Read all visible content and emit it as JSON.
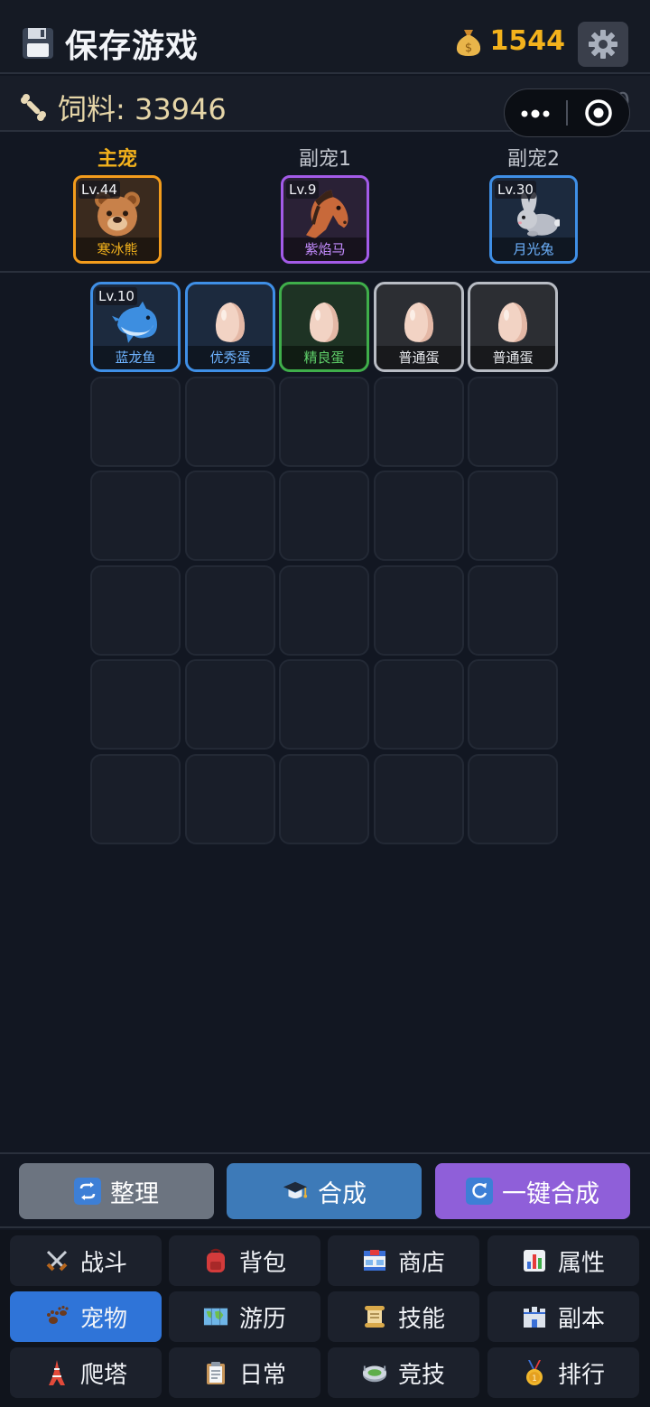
{
  "header": {
    "save_label": "保存游戏",
    "coins": "1544",
    "icons": {
      "save": "floppy-disk-icon",
      "coin": "money-bag-icon",
      "settings": "gear-icon"
    }
  },
  "feed": {
    "label": "饲料: 33946",
    "capacity": "5/30",
    "icon": "bone-icon"
  },
  "capsule": {
    "more_icon": "more-dots-icon",
    "close_icon": "target-circle-icon"
  },
  "equipped": {
    "main": {
      "label": "主宠",
      "level": "Lv.44",
      "name": "寒冰熊",
      "art": "bear",
      "border": "#f39c1c",
      "name_color": "#f3b21c",
      "bg": "#3a2a1e"
    },
    "sub1": {
      "label": "副宠1",
      "level": "Lv.9",
      "name": "紫焰马",
      "art": "horse",
      "border": "#a35be8",
      "name_color": "#c58cff",
      "bg": "#2a2136"
    },
    "sub2": {
      "label": "副宠2",
      "level": "Lv.30",
      "name": "月光兔",
      "art": "rabbit",
      "border": "#3f8fe6",
      "name_color": "#6eb3ff",
      "bg": "#1c2a3e"
    }
  },
  "bag": {
    "items": [
      {
        "level": "Lv.10",
        "name": "蓝龙鱼",
        "art": "dolphin",
        "border": "#3f8fe6",
        "name_color": "#6eb3ff",
        "bg": "#1c2a3e"
      },
      {
        "level": "",
        "name": "优秀蛋",
        "art": "egg",
        "border": "#3f8fe6",
        "name_color": "#6eb3ff",
        "bg": "#1c2a3e"
      },
      {
        "level": "",
        "name": "精良蛋",
        "art": "egg",
        "border": "#3fae4a",
        "name_color": "#5fd06a",
        "bg": "#1e3324"
      },
      {
        "level": "",
        "name": "普通蛋",
        "art": "egg",
        "border": "#b8bcc4",
        "name_color": "#e6e8ec",
        "bg": "#2c2e33"
      },
      {
        "level": "",
        "name": "普通蛋",
        "art": "egg",
        "border": "#b8bcc4",
        "name_color": "#e6e8ec",
        "bg": "#2c2e33"
      }
    ],
    "total_slots": 30
  },
  "actions": [
    {
      "label": "整理",
      "icon": "repeat-arrows-icon",
      "bg": "#6c7480",
      "icon_bg": "#3d7fd6"
    },
    {
      "label": "合成",
      "icon": "mortarboard-icon",
      "bg": "#3d7ab8",
      "icon_bg": "transparent"
    },
    {
      "label": "一键合成",
      "icon": "refresh-icon",
      "bg": "#8f5fd9",
      "icon_bg": "#3d7fd6"
    }
  ],
  "nav": [
    {
      "label": "战斗",
      "icon": "crossed-swords-icon",
      "active": false
    },
    {
      "label": "背包",
      "icon": "backpack-icon",
      "active": false
    },
    {
      "label": "商店",
      "icon": "convenience-store-icon",
      "active": false
    },
    {
      "label": "属性",
      "icon": "bar-chart-icon",
      "active": false
    },
    {
      "label": "宠物",
      "icon": "paw-prints-icon",
      "active": true
    },
    {
      "label": "游历",
      "icon": "world-map-icon",
      "active": false
    },
    {
      "label": "技能",
      "icon": "scroll-icon",
      "active": false
    },
    {
      "label": "副本",
      "icon": "castle-icon",
      "active": false
    },
    {
      "label": "爬塔",
      "icon": "tower-icon",
      "active": false
    },
    {
      "label": "日常",
      "icon": "clipboard-icon",
      "active": false
    },
    {
      "label": "竞技",
      "icon": "stadium-icon",
      "active": false
    },
    {
      "label": "排行",
      "icon": "medal-icon",
      "active": false
    }
  ]
}
